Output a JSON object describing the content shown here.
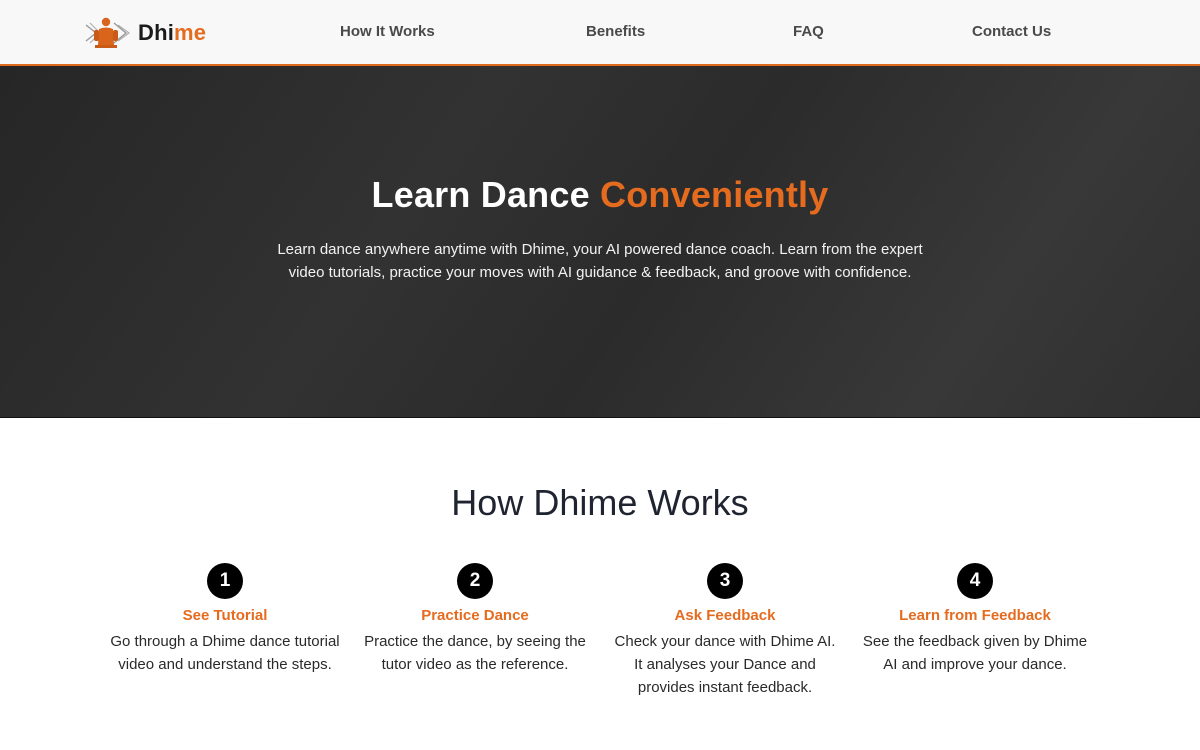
{
  "brand": {
    "name_part1": "Dhi",
    "name_part2": "me",
    "logo_icon": "dancer-logo-icon",
    "accent_color": "#e56b1f"
  },
  "nav": {
    "items": [
      {
        "label": "How It Works"
      },
      {
        "label": "Benefits"
      },
      {
        "label": "FAQ"
      },
      {
        "label": "Contact Us"
      }
    ]
  },
  "hero": {
    "title_part1": "Learn Dance ",
    "title_accent": "Conveniently",
    "description": "Learn dance anywhere anytime with Dhime, your AI powered dance coach. Learn from the expert video tutorials, practice your moves with AI guidance & feedback, and groove with confidence."
  },
  "how": {
    "title": "How Dhime Works",
    "steps": [
      {
        "number": "1",
        "title": "See Tutorial",
        "text": "Go through a Dhime dance tutorial video and understand the steps."
      },
      {
        "number": "2",
        "title": "Practice Dance",
        "text": "Practice the dance, by seeing the tutor video as the reference."
      },
      {
        "number": "3",
        "title": "Ask Feedback",
        "text": "Check your dance with Dhime AI. It analyses your Dance and provides instant feedback."
      },
      {
        "number": "4",
        "title": "Learn from Feedback",
        "text": "See the feedback given by Dhime AI and improve your dance."
      }
    ]
  }
}
